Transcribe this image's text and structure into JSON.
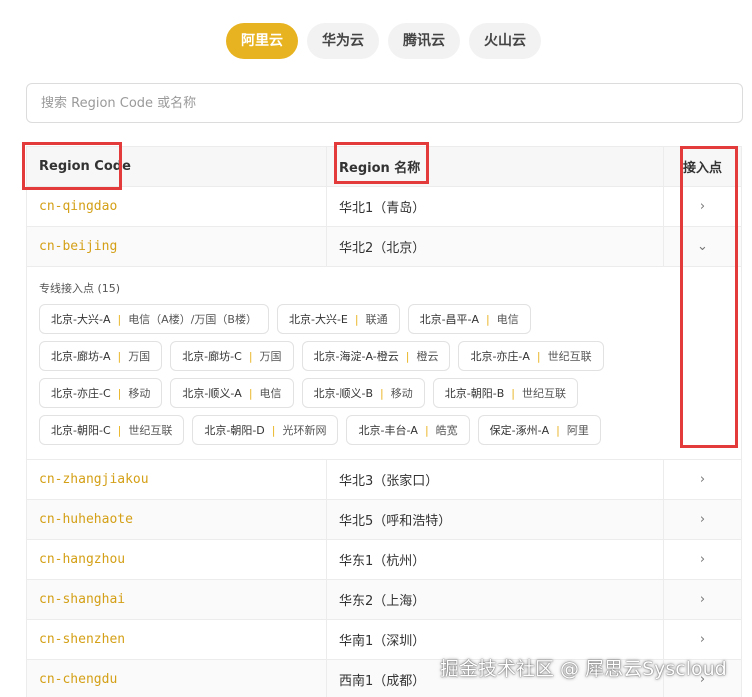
{
  "providers": [
    {
      "label": "阿里云",
      "active": true
    },
    {
      "label": "华为云",
      "active": false
    },
    {
      "label": "腾讯云",
      "active": false
    },
    {
      "label": "火山云",
      "active": false
    }
  ],
  "search": {
    "placeholder": "搜索 Region Code 或名称",
    "value": ""
  },
  "table": {
    "headers": {
      "code": "Region Code",
      "name": "Region 名称",
      "access": "接入点"
    },
    "rows": [
      {
        "code": "cn-qingdao",
        "name": "华北1（青岛）",
        "chevron": "›"
      },
      {
        "code": "cn-beijing",
        "name": "华北2（北京）",
        "chevron": "⌄"
      },
      {
        "code": "cn-zhangjiakou",
        "name": "华北3（张家口）",
        "chevron": "›"
      },
      {
        "code": "cn-huhehaote",
        "name": "华北5（呼和浩特）",
        "chevron": "›"
      },
      {
        "code": "cn-hangzhou",
        "name": "华东1（杭州）",
        "chevron": "›"
      },
      {
        "code": "cn-shanghai",
        "name": "华东2（上海）",
        "chevron": "›"
      },
      {
        "code": "cn-shenzhen",
        "name": "华南1（深圳）",
        "chevron": "›"
      },
      {
        "code": "cn-chengdu",
        "name": "西南1（成都）",
        "chevron": "›"
      }
    ]
  },
  "expanded": {
    "title": "专线接入点 (15)",
    "separator": "|",
    "chips": [
      {
        "loc": "北京-大兴-A",
        "isp": "电信（A楼）/万国（B楼）"
      },
      {
        "loc": "北京-大兴-E",
        "isp": "联通"
      },
      {
        "loc": "北京-昌平-A",
        "isp": "电信"
      },
      {
        "loc": "北京-廊坊-A",
        "isp": "万国"
      },
      {
        "loc": "北京-廊坊-C",
        "isp": "万国"
      },
      {
        "loc": "北京-海淀-A-橙云",
        "isp": "橙云"
      },
      {
        "loc": "北京-亦庄-A",
        "isp": "世纪互联"
      },
      {
        "loc": "北京-亦庄-C",
        "isp": "移动"
      },
      {
        "loc": "北京-顺义-A",
        "isp": "电信"
      },
      {
        "loc": "北京-顺义-B",
        "isp": "移动"
      },
      {
        "loc": "北京-朝阳-B",
        "isp": "世纪互联"
      },
      {
        "loc": "北京-朝阳-C",
        "isp": "世纪互联"
      },
      {
        "loc": "北京-朝阳-D",
        "isp": "光环新网"
      },
      {
        "loc": "北京-丰台-A",
        "isp": "皓宽"
      },
      {
        "loc": "保定-涿州-A",
        "isp": "阿里"
      }
    ]
  },
  "watermark": "掘金技术社区 @ 犀思云Syscloud",
  "colors": {
    "accent": "#e8b320",
    "code": "#d4a017",
    "annotation": "#e33b3b"
  }
}
